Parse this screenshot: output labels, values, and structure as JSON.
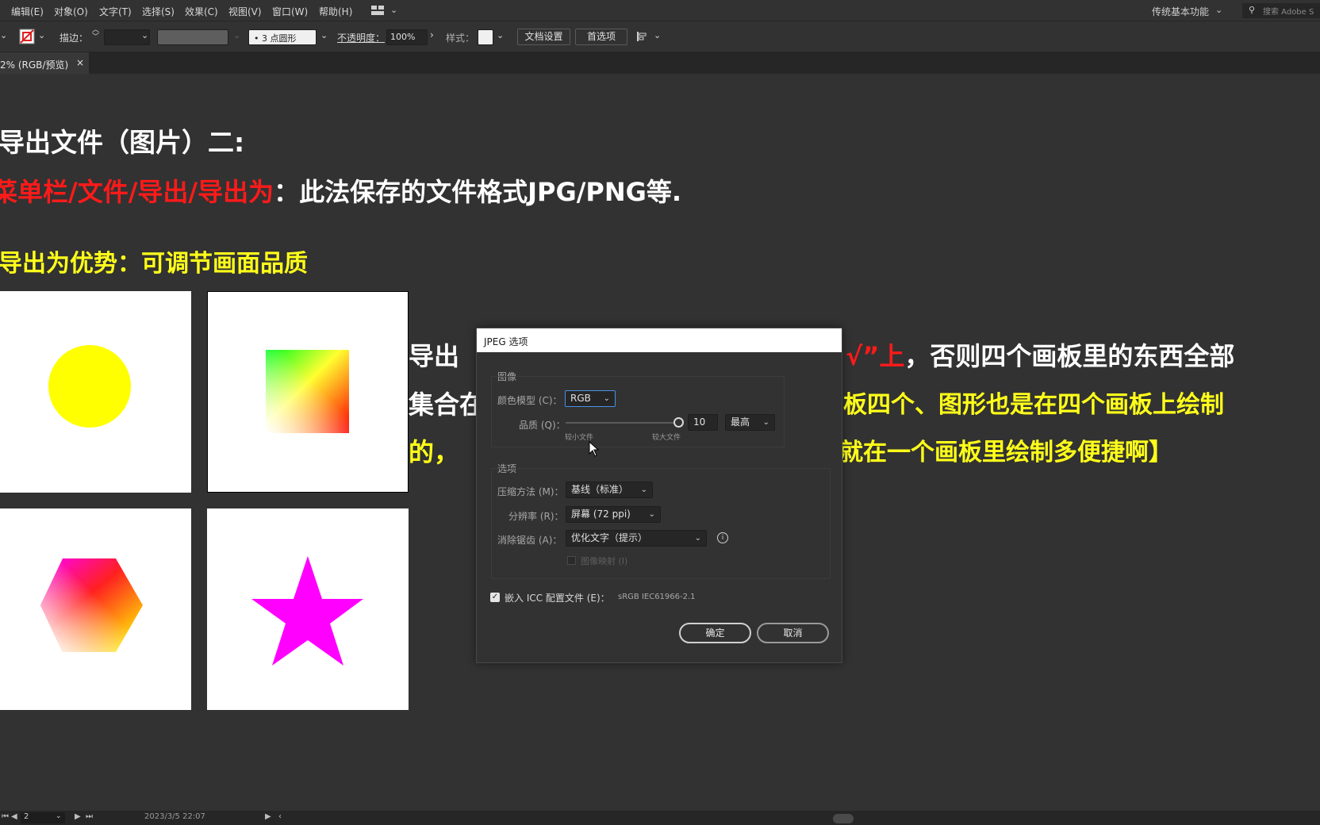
{
  "menu": {
    "items": [
      "编辑(E)",
      "对象(O)",
      "文字(T)",
      "选择(S)",
      "效果(C)",
      "视图(V)",
      "窗口(W)",
      "帮助(H)"
    ],
    "workspace": "传统基本功能",
    "search_placeholder": "搜索 Adobe S"
  },
  "control": {
    "stroke_label": "描边",
    "brush_label": "3 点圆形",
    "opacity_label": "不透明度",
    "opacity_value": "100%",
    "style_label": "样式",
    "doc_setup": "文档设置",
    "preferences": "首选项"
  },
  "tab": {
    "title": "2% (RGB/预览)",
    "close": "×"
  },
  "canvas": {
    "heading": "导出文件（图片）二:",
    "line2_red": "菜单栏/文件/导出/导出为",
    "line2_white": "：此法保存的文件格式JPG/PNG等.",
    "line3": "导出为优势：可调节画面品质",
    "line4_a": "导出",
    "line4_red": "√”上",
    "line4_b": "，否则四个画板里的东西全部",
    "line5_a": "集合在",
    "line5_b": "板四个、图形也是在四个画板上绘制",
    "line6_a": "的，",
    "line6_b": "就在一个画板里绘制多便捷啊】"
  },
  "dialog": {
    "title": "JPEG 选项",
    "image_group": "图像",
    "color_model_label": "颜色模型 (C)：",
    "color_model_value": "RGB",
    "quality_label": "品质 (Q)：",
    "quality_value": "10",
    "quality_preset": "最高",
    "quality_level": 1.0,
    "smaller_file": "较小文件",
    "larger_file": "较大文件",
    "options_group": "选项",
    "compression_label": "压缩方法 (M)：",
    "compression_value": "基线（标准）",
    "resolution_label": "分辨率 (R)：",
    "resolution_value": "屏幕 (72 ppi)",
    "antialias_label": "消除锯齿 (A)：",
    "antialias_value": "优化文字（提示）",
    "image_map_label": "图像映射 (I)",
    "embed_icc_label": "嵌入 ICC 配置文件 (E)：",
    "icc_profile": "sRGB IEC61966-2.1",
    "ok": "确定",
    "cancel": "取消"
  },
  "status": {
    "page": "2",
    "datetime": "2023/3/5  22:07"
  },
  "colors": {
    "yellow": "#ffff00",
    "red": "#ff1a1a",
    "magenta": "#ff00ff"
  }
}
